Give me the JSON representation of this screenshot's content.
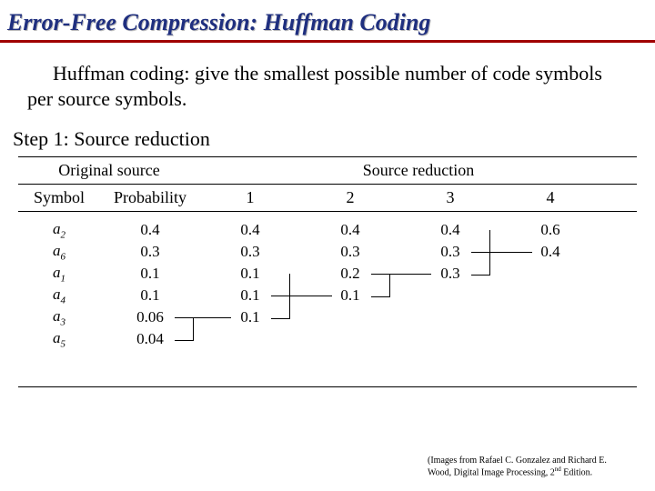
{
  "title": "Error-Free Compression: Huffman Coding",
  "paragraph": "Huffman coding: give the smallest possible number of code symbols per source symbols.",
  "step_label": "Step 1: Source reduction",
  "table": {
    "orig_header": "Original source",
    "red_header": "Source reduction",
    "sym_header": "Symbol",
    "prob_header": "Probability",
    "red_cols": [
      "1",
      "2",
      "3",
      "4"
    ],
    "rows": [
      {
        "sym_letter": "a",
        "sym_sub": "2",
        "prob": "0.4",
        "r1": "0.4",
        "r2": "0.4",
        "r3": "0.4",
        "r4": "0.6"
      },
      {
        "sym_letter": "a",
        "sym_sub": "6",
        "prob": "0.3",
        "r1": "0.3",
        "r2": "0.3",
        "r3": "0.3",
        "r4": "0.4"
      },
      {
        "sym_letter": "a",
        "sym_sub": "1",
        "prob": "0.1",
        "r1": "0.1",
        "r2": "0.2",
        "r3": "0.3",
        "r4": ""
      },
      {
        "sym_letter": "a",
        "sym_sub": "4",
        "prob": "0.1",
        "r1": "0.1",
        "r2": "0.1",
        "r3": "",
        "r4": ""
      },
      {
        "sym_letter": "a",
        "sym_sub": "3",
        "prob": "0.06",
        "r1": "0.1",
        "r2": "",
        "r3": "",
        "r4": ""
      },
      {
        "sym_letter": "a",
        "sym_sub": "5",
        "prob": "0.04",
        "r1": "",
        "r2": "",
        "r3": "",
        "r4": ""
      }
    ]
  },
  "credit": {
    "line1": "(Images from Rafael C. Gonzalez and Richard E.",
    "line2_a": "Wood, Digital Image Processing, 2",
    "line2_sup": "nd",
    "line2_b": " Edition."
  }
}
